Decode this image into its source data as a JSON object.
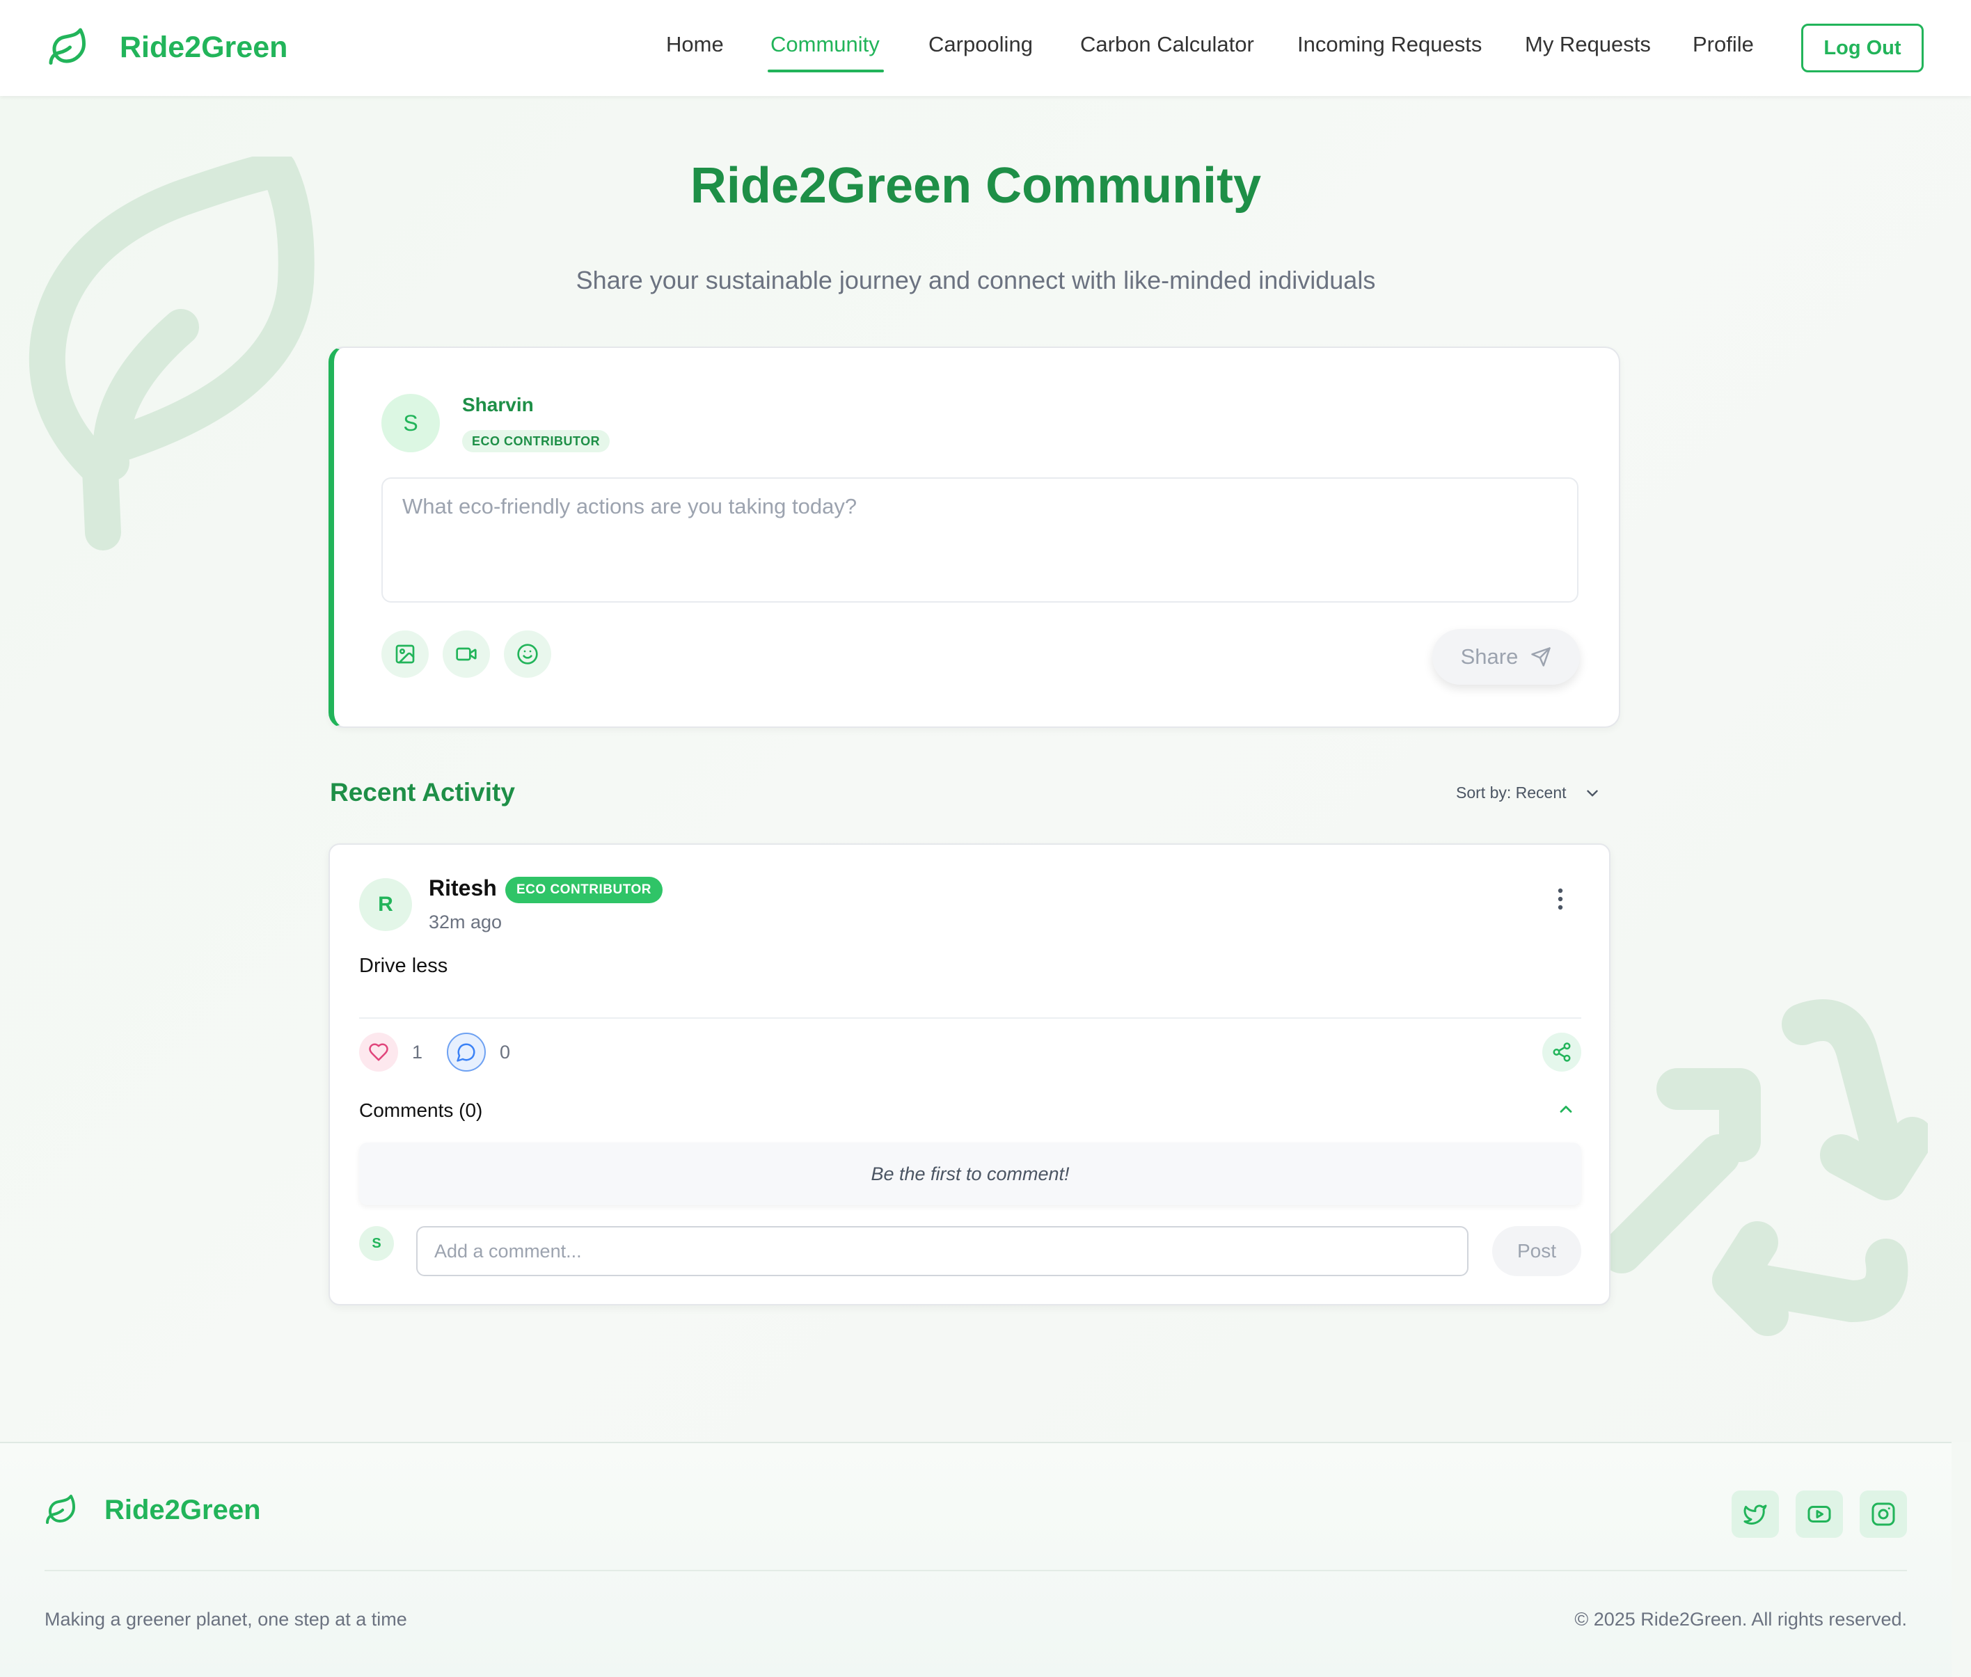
{
  "brand": {
    "name": "Ride2Green",
    "color": "#22b45a",
    "icon": "leaf-icon"
  },
  "nav": {
    "links": [
      "Home",
      "Community",
      "Carpooling",
      "Carbon Calculator",
      "Incoming Requests",
      "My Requests",
      "Profile"
    ],
    "active": "Community",
    "logout_label": "Log Out"
  },
  "header": {
    "title": "Ride2Green Community",
    "subtitle": "Share your sustainable journey and connect with like-minded individuals"
  },
  "composer": {
    "avatar_initial": "S",
    "user_name": "Sharvin",
    "badge": "ECO CONTRIBUTOR",
    "placeholder": "What eco-friendly actions are you taking today?",
    "tools": [
      "image-icon",
      "video-icon",
      "smiley-icon"
    ],
    "share_label": "Share"
  },
  "feed": {
    "title": "Recent Activity",
    "sort_label": "Sort by: Recent"
  },
  "post": {
    "avatar_initial": "R",
    "author": "Ritesh",
    "badge": "ECO CONTRIBUTOR",
    "time": "32m ago",
    "text": "Drive less",
    "likes": "1",
    "comments_count": "0",
    "comments_title": "Comments (0)",
    "empty_message": "Be the first to comment!",
    "commenter_initial": "S",
    "comment_placeholder": "Add a comment...",
    "post_label": "Post"
  },
  "footer": {
    "brand": "Ride2Green",
    "tagline": "Making a greener planet, one step at a time",
    "copyright": "© 2025 Ride2Green. All rights reserved.",
    "social": [
      "twitter-icon",
      "youtube-icon",
      "instagram-icon"
    ]
  }
}
